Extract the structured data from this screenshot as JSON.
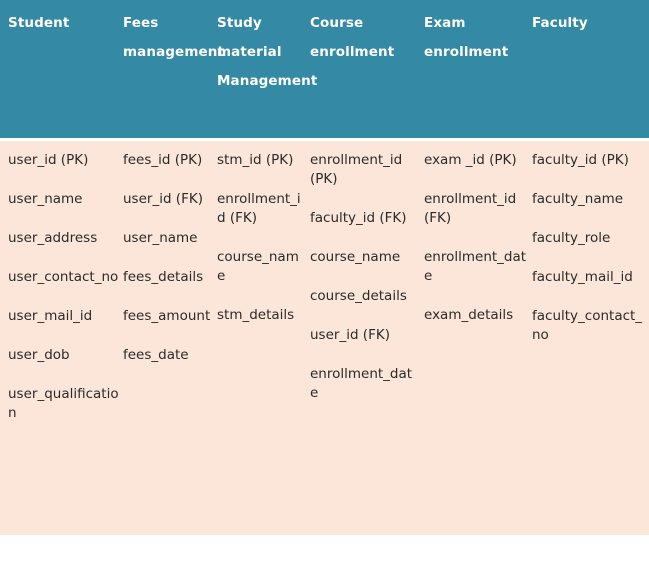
{
  "table": {
    "accent_header_color": "#3489a5",
    "body_color": "#fbe6d9",
    "header_text_color": "#ffffff",
    "body_text_color": "#2b2b2b",
    "columns": [
      {
        "header": "Student",
        "fields": [
          "user_id (PK)",
          "user_name",
          "user_address",
          "user_contact_no",
          "user_mail_id",
          "user_dob",
          "user_qualification"
        ]
      },
      {
        "header": "Fees management",
        "fields": [
          "fees_id (PK)",
          "user_id (FK)",
          "user_name",
          "fees_details",
          "fees_amount",
          "fees_date"
        ]
      },
      {
        "header": "Study material Management",
        "fields": [
          "stm_id (PK)",
          "enrollment_id (FK)",
          "course_name",
          "stm_details"
        ]
      },
      {
        "header": "Course enrollment",
        "fields": [
          "enrollment_id (PK)",
          "faculty_id (FK)",
          "course_name",
          "course_details",
          "user_id (FK)",
          "enrollment_date"
        ]
      },
      {
        "header": "Exam enrollment",
        "fields": [
          "exam _id (PK)",
          "enrollment_id (FK)",
          "enrollment_date",
          "exam_details"
        ]
      },
      {
        "header": "Faculty",
        "fields": [
          "faculty_id (PK)",
          "faculty_name",
          "faculty_role",
          "faculty_mail_id",
          "faculty_contact_no"
        ]
      }
    ]
  }
}
